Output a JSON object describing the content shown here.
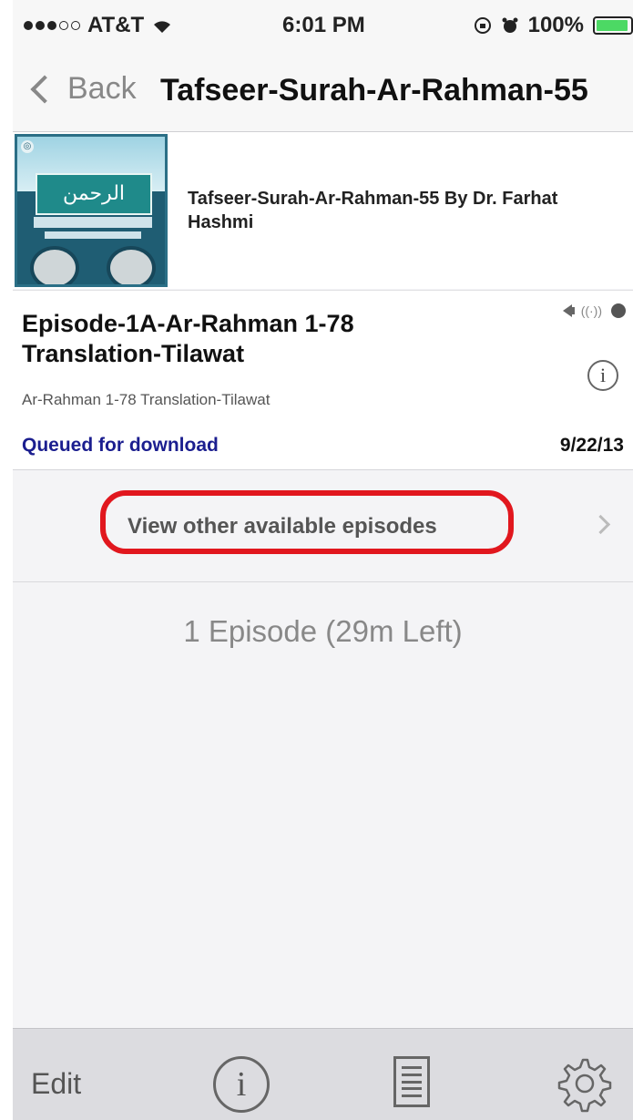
{
  "status_bar": {
    "carrier": "AT&T",
    "time": "6:01 PM",
    "battery": "100%",
    "signal_bars_filled": 3,
    "signal_bars_total": 5
  },
  "nav": {
    "back_label": "Back",
    "title": "Tafseer-Surah-Ar-Rahman-55"
  },
  "podcast": {
    "title": "Tafseer-Surah-Ar-Rahman-55 By Dr. Farhat Hashmi",
    "artwork_text": "الرحمن"
  },
  "episode": {
    "title": "Episode-1A-Ar-Rahman 1-78 Translation-Tilawat",
    "subtitle": "Ar-Rahman 1-78 Translation-Tilawat",
    "status": "Queued for download",
    "date": "9/22/13"
  },
  "view_other": {
    "label": "View other available episodes"
  },
  "summary": "1 Episode (29m Left)",
  "toolbar": {
    "edit_label": "Edit"
  },
  "colors": {
    "status_text": "#1b1e8f",
    "highlight_ring": "#e1171e",
    "battery": "#4cd964"
  },
  "icons": [
    "wifi-icon",
    "alarm-icon",
    "lock-rotation-icon",
    "battery-icon",
    "chevron-left-icon",
    "speaker-icon",
    "info-icon",
    "chevron-right-icon",
    "list-icon",
    "gear-icon"
  ]
}
